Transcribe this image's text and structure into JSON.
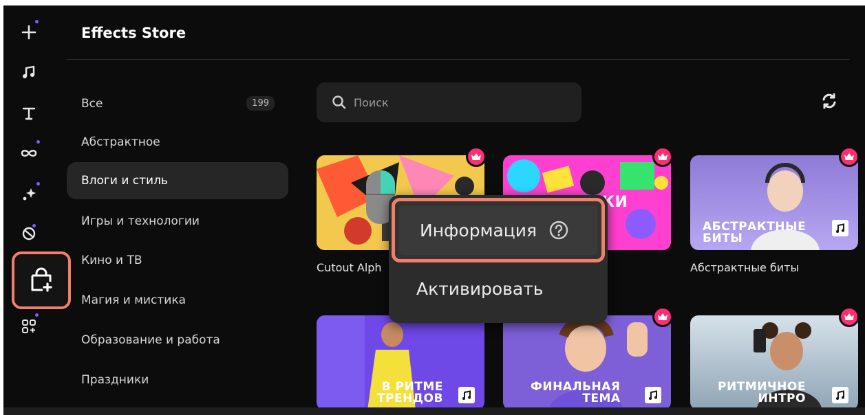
{
  "header": {
    "title": "Effects Store"
  },
  "rail": {
    "items": [
      {
        "name": "add-icon",
        "has_dot": true
      },
      {
        "name": "music-icon",
        "has_dot": false
      },
      {
        "name": "text-icon",
        "has_dot": false
      },
      {
        "name": "transitions-icon",
        "has_dot": true
      },
      {
        "name": "effects-icon",
        "has_dot": true
      },
      {
        "name": "stickers-icon",
        "has_dot": true
      },
      {
        "name": "effects-store-icon",
        "has_dot": false
      },
      {
        "name": "more-apps-icon",
        "has_dot": true
      }
    ],
    "accent_color": "#7a5cff",
    "highlight_color": "#f27f68"
  },
  "sidebar": {
    "categories": [
      {
        "label": "Все",
        "count": "199"
      },
      {
        "label": "Абстрактное"
      },
      {
        "label": "Влоги и стиль",
        "active": true
      },
      {
        "label": "Игры и технологии"
      },
      {
        "label": "Кино и ТВ"
      },
      {
        "label": "Магия и мистика"
      },
      {
        "label": "Образование и работа"
      },
      {
        "label": "Праздники"
      }
    ]
  },
  "search": {
    "placeholder": "Поиск"
  },
  "cards": [
    {
      "caption": "Cutout Alph",
      "premium": true
    },
    {
      "caption": "",
      "overlay": "КИ",
      "premium": true
    },
    {
      "caption": "Абстрактные биты",
      "overlay_line1": "АБСТРАКТНЫЕ",
      "overlay_line2": "БИТЫ",
      "premium": true
    },
    {
      "overlay_line1": "В РИТМЕ",
      "overlay_line2": "ТРЕНДОВ",
      "premium": false
    },
    {
      "overlay_line1": "ФИНАЛЬНАЯ",
      "overlay_line2": "ТЕМА",
      "premium": true
    },
    {
      "overlay_line1": "РИТМИЧНОЕ",
      "overlay_line2": "ИНТРО",
      "premium": true
    }
  ],
  "context_menu": {
    "info_label": "Информация",
    "activate_label": "Активировать"
  },
  "colors": {
    "background": "#0c0c0c",
    "premium": "#ff2d73",
    "highlight": "#f27f68"
  }
}
